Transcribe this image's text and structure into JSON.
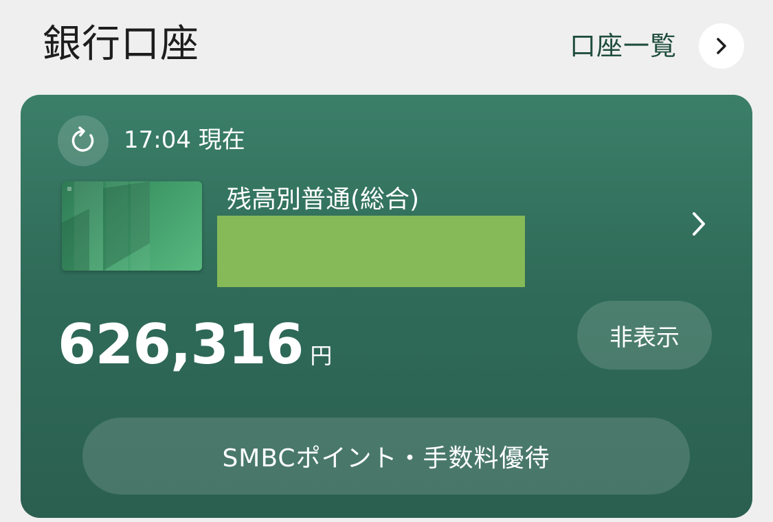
{
  "header": {
    "title": "銀行口座",
    "account_list_label": "口座一覧"
  },
  "card": {
    "updated_time": "17:04 現在",
    "account_name": "残高別普通(総合)",
    "balance_amount": "626,316",
    "balance_unit": "円",
    "hide_button_label": "非表示",
    "perk_button_label": "SMBCポイント・手数料優待"
  },
  "colors": {
    "card_background": "#2f6b58",
    "accent_dark_green": "#1f4d3e",
    "redacted_block": "#86b958",
    "page_background": "#efefef"
  },
  "icons": {
    "header_chevron": "chevron-right-icon",
    "refresh": "refresh-icon",
    "row_chevron": "chevron-right-icon"
  }
}
